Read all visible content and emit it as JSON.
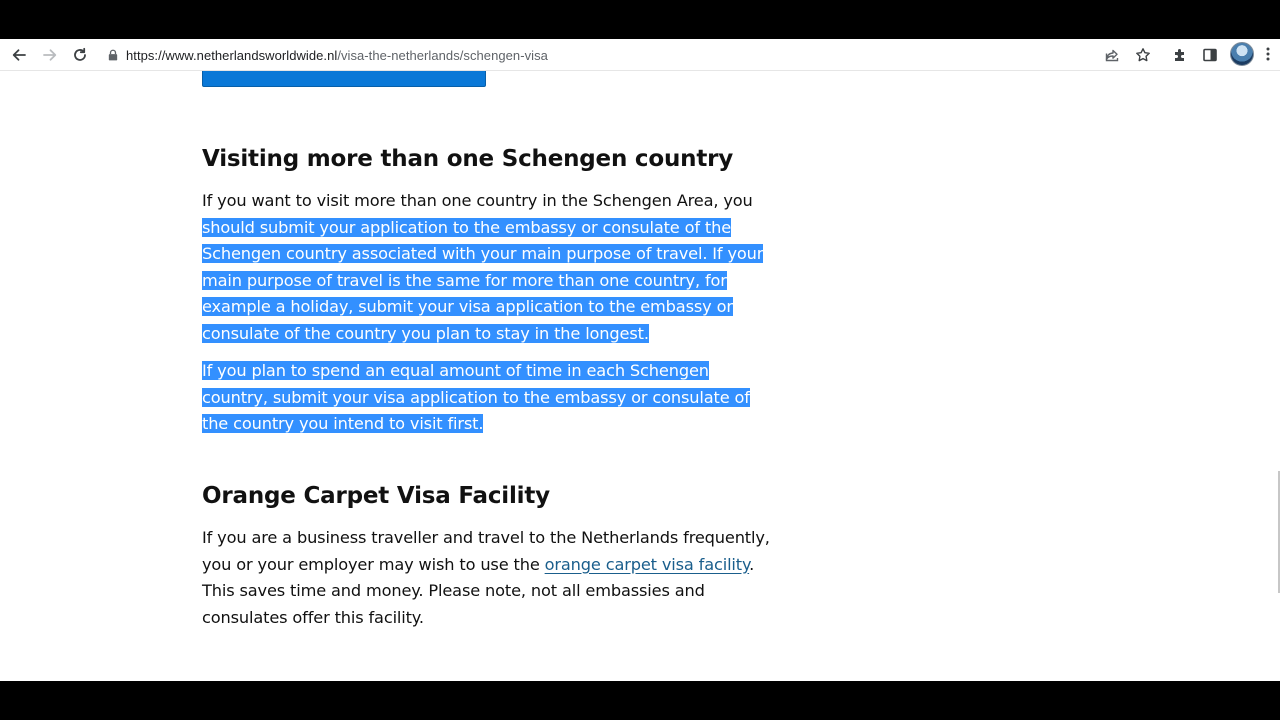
{
  "browser": {
    "url_domain": "https://www.netherlandsworldwide.nl",
    "url_path": "/visa-the-netherlands/schengen-visa",
    "icons": [
      "back-icon",
      "forward-icon",
      "reload-icon",
      "lock-icon",
      "share-icon",
      "star-icon",
      "extensions-icon",
      "side-panel-icon",
      "profile-avatar",
      "menu-icon"
    ]
  },
  "section1": {
    "heading": "Visiting more than one Schengen country",
    "p1_plain": "If you want to visit more than one country in the Schengen Area, you ",
    "p1_selected": "should submit your application to the embassy or consulate of the Schengen country associated with your main purpose of travel. If your main purpose of travel is the same for more than one country, for example a holiday, submit your visa application to the embassy or consulate of the country you plan to stay in the longest.",
    "p2_selected": "If you plan to spend an equal amount of time in each Schengen country, submit your visa application to the embassy or consulate of the country you intend to visit first."
  },
  "section2": {
    "heading": "Orange Carpet Visa Facility",
    "p_before_link": "If you are a business traveller and travel to the Netherlands frequently, you or your employer may wish to use the ",
    "link_text": "orange carpet visa facility",
    "p_after_link": ". This saves time and money. Please note, not all embassies and consulates offer this facility."
  },
  "colors": {
    "selection": "#3390ff",
    "link": "#1a5e8c",
    "button_blue": "#0a78d7"
  }
}
